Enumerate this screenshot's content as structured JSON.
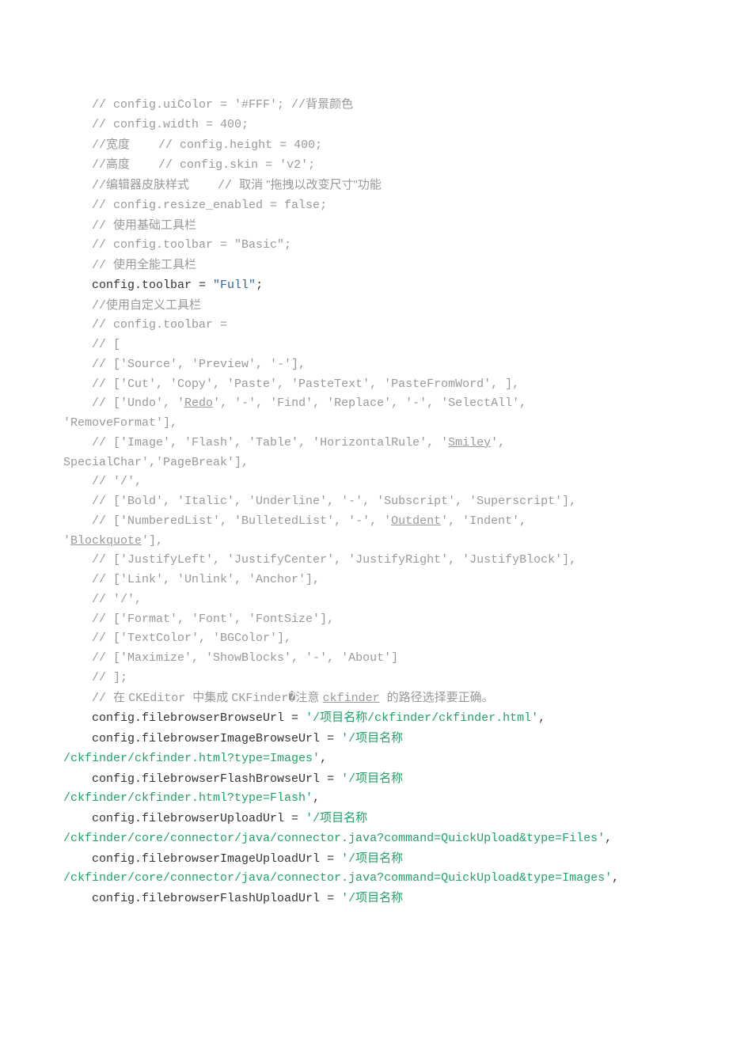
{
  "code_lines": [
    {
      "indent": 1,
      "segments": [
        {
          "text": "// config.uiColor = '#FFF'; //",
          "cls": "comment"
        },
        {
          "text": "背景颜色",
          "cls": "cjk-comment"
        }
      ]
    },
    {
      "indent": 1,
      "segments": [
        {
          "text": "// config.width = 400;",
          "cls": "comment"
        }
      ]
    },
    {
      "indent": 1,
      "segments": [
        {
          "text": "//",
          "cls": "comment"
        },
        {
          "text": "宽度",
          "cls": "cjk-comment"
        },
        {
          "text": "    // config.height = 400;",
          "cls": "comment"
        }
      ]
    },
    {
      "indent": 1,
      "segments": [
        {
          "text": "//",
          "cls": "comment"
        },
        {
          "text": "高度",
          "cls": "cjk-comment"
        },
        {
          "text": "    // config.skin = 'v2';",
          "cls": "comment"
        }
      ]
    },
    {
      "indent": 1,
      "segments": [
        {
          "text": "//",
          "cls": "comment"
        },
        {
          "text": "编辑器皮肤样式",
          "cls": "cjk-comment"
        },
        {
          "text": "    // ",
          "cls": "comment"
        },
        {
          "text": "取消 \"拖拽以改变尺寸\"功能",
          "cls": "cjk-comment"
        }
      ]
    },
    {
      "indent": 1,
      "segments": [
        {
          "text": "// config.resize_enabled = false;",
          "cls": "comment"
        }
      ]
    },
    {
      "indent": 1,
      "segments": [
        {
          "text": "// ",
          "cls": "comment"
        },
        {
          "text": "使用基础工具栏",
          "cls": "cjk-comment"
        }
      ]
    },
    {
      "indent": 1,
      "segments": [
        {
          "text": "// config.toolbar = \"Basic\";",
          "cls": "comment"
        }
      ]
    },
    {
      "indent": 1,
      "segments": [
        {
          "text": "// ",
          "cls": "comment"
        },
        {
          "text": "使用全能工具栏",
          "cls": "cjk-comment"
        }
      ]
    },
    {
      "indent": 1,
      "segments": [
        {
          "text": "config.toolbar = ",
          "cls": "keyword"
        },
        {
          "text": "\"Full\"",
          "cls": "string-alt"
        },
        {
          "text": ";",
          "cls": "keyword"
        }
      ]
    },
    {
      "indent": 1,
      "segments": [
        {
          "text": "//",
          "cls": "comment"
        },
        {
          "text": "使用自定义工具栏",
          "cls": "cjk-comment"
        }
      ]
    },
    {
      "indent": 1,
      "segments": [
        {
          "text": "// config.toolbar =",
          "cls": "comment"
        }
      ]
    },
    {
      "indent": 1,
      "segments": [
        {
          "text": "// [",
          "cls": "comment"
        }
      ]
    },
    {
      "indent": 1,
      "segments": [
        {
          "text": "// ['Source', 'Preview', '-'],",
          "cls": "comment"
        }
      ]
    },
    {
      "indent": 1,
      "segments": [
        {
          "text": "// ['Cut', 'Copy', 'Paste', 'PasteText', 'PasteFromWord', ],",
          "cls": "comment"
        }
      ]
    },
    {
      "indent": 1,
      "segments": [
        {
          "text": "// ['Undo', '",
          "cls": "comment"
        },
        {
          "text": "Redo",
          "cls": "comment underline"
        },
        {
          "text": "', '-', 'Find', 'Replace', '-', 'SelectAll', ",
          "cls": "comment"
        }
      ]
    },
    {
      "indent": 0,
      "segments": [
        {
          "text": "'RemoveFormat'],",
          "cls": "comment"
        }
      ]
    },
    {
      "indent": 1,
      "segments": [
        {
          "text": "// ['Image', 'Flash', 'Table', 'HorizontalRule', '",
          "cls": "comment"
        },
        {
          "text": "Smiley",
          "cls": "comment underline"
        },
        {
          "text": "', ",
          "cls": "comment"
        }
      ]
    },
    {
      "indent": 0,
      "segments": [
        {
          "text": "SpecialChar','PageBreak'],",
          "cls": "comment"
        }
      ]
    },
    {
      "indent": 1,
      "segments": [
        {
          "text": "// '/',",
          "cls": "comment"
        }
      ]
    },
    {
      "indent": 1,
      "segments": [
        {
          "text": "// ['Bold', 'Italic', 'Underline', '-', 'Subscript', 'Superscript'],",
          "cls": "comment"
        }
      ]
    },
    {
      "indent": 1,
      "segments": [
        {
          "text": "// ['NumberedList', 'BulletedList', '-', '",
          "cls": "comment"
        },
        {
          "text": "Outdent",
          "cls": "comment underline"
        },
        {
          "text": "', 'Indent', ",
          "cls": "comment"
        }
      ]
    },
    {
      "indent": 0,
      "segments": [
        {
          "text": "'",
          "cls": "comment"
        },
        {
          "text": "Blockquote",
          "cls": "comment underline"
        },
        {
          "text": "'],",
          "cls": "comment"
        }
      ]
    },
    {
      "indent": 1,
      "segments": [
        {
          "text": "// ['JustifyLeft', 'JustifyCenter', 'JustifyRight', 'JustifyBlock'],",
          "cls": "comment"
        }
      ]
    },
    {
      "indent": 1,
      "segments": [
        {
          "text": "// ['Link', 'Unlink', 'Anchor'],",
          "cls": "comment"
        }
      ]
    },
    {
      "indent": 1,
      "segments": [
        {
          "text": "// '/',",
          "cls": "comment"
        }
      ]
    },
    {
      "indent": 1,
      "segments": [
        {
          "text": "// ['Format', 'Font', 'FontSize'],",
          "cls": "comment"
        }
      ]
    },
    {
      "indent": 1,
      "segments": [
        {
          "text": "// ['TextColor', 'BGColor'],",
          "cls": "comment"
        }
      ]
    },
    {
      "indent": 1,
      "segments": [
        {
          "text": "// ['Maximize', 'ShowBlocks', '-', 'About']",
          "cls": "comment"
        }
      ]
    },
    {
      "indent": 1,
      "segments": [
        {
          "text": "// ];",
          "cls": "comment"
        }
      ]
    },
    {
      "indent": 1,
      "segments": [
        {
          "text": "// ",
          "cls": "comment"
        },
        {
          "text": "在 ",
          "cls": "cjk-comment"
        },
        {
          "text": "CKEditor ",
          "cls": "comment"
        },
        {
          "text": "中集成 ",
          "cls": "cjk-comment"
        },
        {
          "text": "CKFinder�",
          "cls": "comment"
        },
        {
          "text": "注意 ",
          "cls": "cjk-comment"
        },
        {
          "text": "ckfinder",
          "cls": "comment underline"
        },
        {
          "text": " ",
          "cls": "comment"
        },
        {
          "text": "的路径选择要正确。",
          "cls": "cjk-comment"
        }
      ]
    },
    {
      "indent": 1,
      "segments": [
        {
          "text": "config.filebrowserBrowseUrl = ",
          "cls": "keyword"
        },
        {
          "text": "'/",
          "cls": "string"
        },
        {
          "text": "项目名称",
          "cls": "string cjk"
        },
        {
          "text": "/ckfinder/ckfinder.html'",
          "cls": "string"
        },
        {
          "text": ",",
          "cls": "keyword"
        }
      ]
    },
    {
      "indent": 1,
      "segments": [
        {
          "text": "config.filebrowserImageBrowseUrl = ",
          "cls": "keyword"
        },
        {
          "text": "'/",
          "cls": "string"
        },
        {
          "text": "项目名称",
          "cls": "string cjk"
        }
      ]
    },
    {
      "indent": 0,
      "segments": [
        {
          "text": "/ckfinder/ckfinder.html?type=Images'",
          "cls": "string"
        },
        {
          "text": ",",
          "cls": "keyword"
        }
      ]
    },
    {
      "indent": 1,
      "segments": [
        {
          "text": "config.filebrowserFlashBrowseUrl = ",
          "cls": "keyword"
        },
        {
          "text": "'/",
          "cls": "string"
        },
        {
          "text": "项目名称",
          "cls": "string cjk"
        }
      ]
    },
    {
      "indent": 0,
      "segments": [
        {
          "text": "/ckfinder/ckfinder.html?type=Flash'",
          "cls": "string"
        },
        {
          "text": ",",
          "cls": "keyword"
        }
      ]
    },
    {
      "indent": 1,
      "segments": [
        {
          "text": "config.filebrowserUploadUrl = ",
          "cls": "keyword"
        },
        {
          "text": "'/",
          "cls": "string"
        },
        {
          "text": "项目名称",
          "cls": "string cjk"
        }
      ]
    },
    {
      "indent": 0,
      "segments": [
        {
          "text": "/ckfinder/core/connector/java/connector.java?command=QuickUpload&type=Files'",
          "cls": "string"
        },
        {
          "text": ",",
          "cls": "keyword"
        }
      ]
    },
    {
      "indent": 1,
      "segments": [
        {
          "text": "config.filebrowserImageUploadUrl = ",
          "cls": "keyword"
        },
        {
          "text": "'/",
          "cls": "string"
        },
        {
          "text": "项目名称",
          "cls": "string cjk"
        }
      ]
    },
    {
      "indent": 0,
      "segments": [
        {
          "text": "/ckfinder/core/connector/java/connector.java?command=QuickUpload&type=Images'",
          "cls": "string"
        },
        {
          "text": ",",
          "cls": "keyword"
        }
      ]
    },
    {
      "indent": 1,
      "segments": [
        {
          "text": "config.filebrowserFlashUploadUrl = ",
          "cls": "keyword"
        },
        {
          "text": "'/",
          "cls": "string"
        },
        {
          "text": "项目名称",
          "cls": "string cjk"
        }
      ]
    }
  ],
  "indent_unit": "    "
}
